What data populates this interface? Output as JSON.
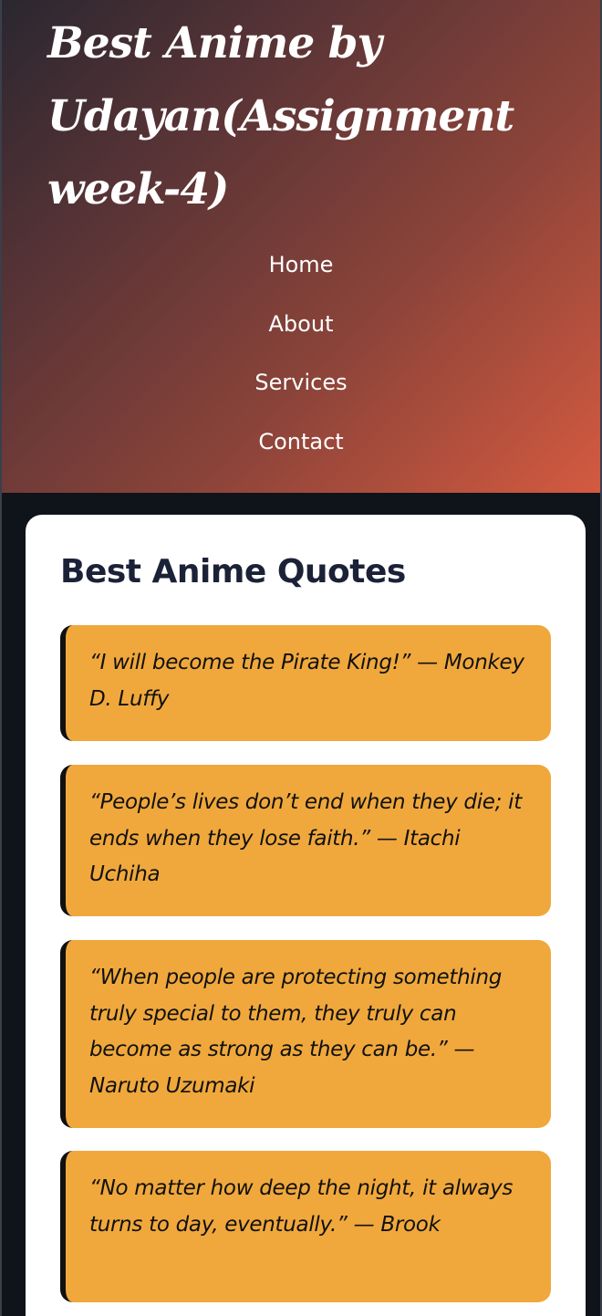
{
  "header": {
    "site_title": "Best Anime by Udayan(Assignment week-4)"
  },
  "nav": {
    "items": [
      {
        "label": "Home"
      },
      {
        "label": "About"
      },
      {
        "label": "Services"
      },
      {
        "label": "Contact"
      }
    ]
  },
  "main": {
    "heading": "Best Anime Quotes",
    "quotes": [
      {
        "text": "“I will become the Pirate King!” — Monkey D. Luffy"
      },
      {
        "text": "“People’s lives don’t end when they die; it ends when they lose faith.” — Itachi Uchiha"
      },
      {
        "text": "“When people are protecting something truly special to them, they truly can become as strong as they can be.” — Naruto Uzumaki"
      },
      {
        "text": "“No matter how deep the night, it always turns to day, eventually.” — Brook"
      }
    ]
  },
  "colors": {
    "quote_background": "#f0a83c",
    "quote_border": "#101010",
    "heading_text": "#1b2237",
    "page_background": "#0f131a",
    "hero_gradient_start": "#2a2730",
    "hero_gradient_end": "#d45a40"
  }
}
